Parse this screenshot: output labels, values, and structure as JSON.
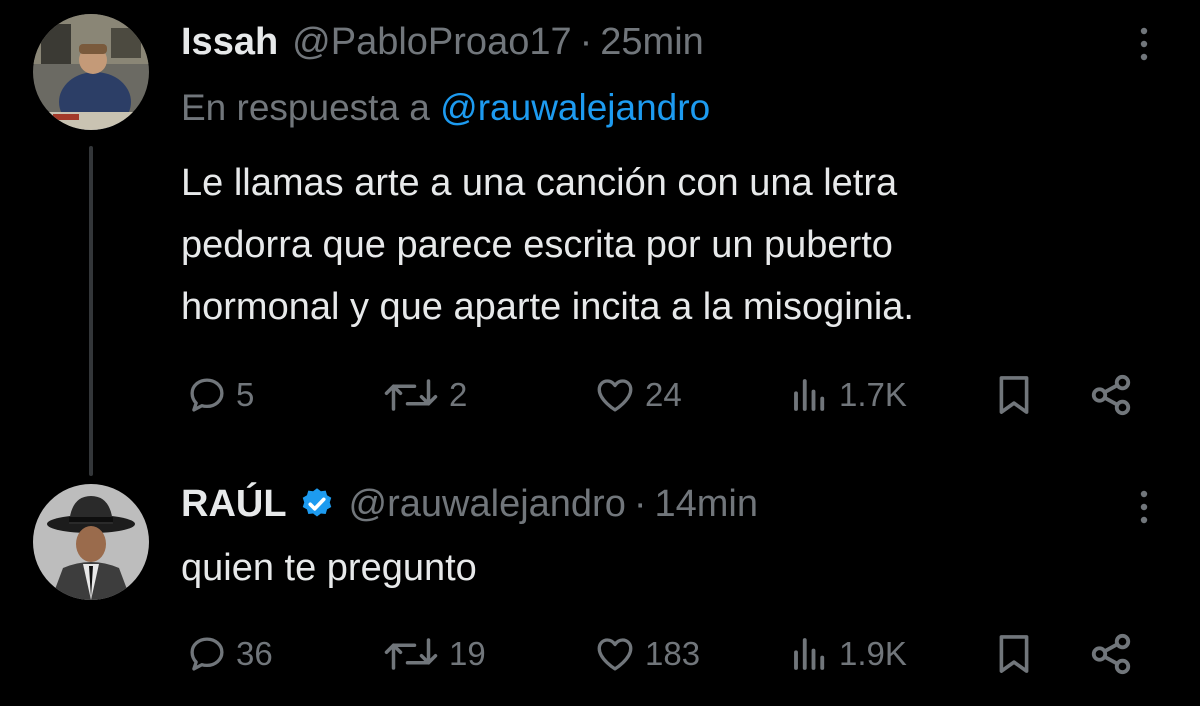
{
  "reply": {
    "author_name": "Issah",
    "handle": "@PabloProao17",
    "separator": "·",
    "time": "25min",
    "reply_prefix": "En respuesta a",
    "reply_mention": "@rauwalejandro",
    "text_lines": [
      "Le llamas arte a una canción con una letra",
      "pedorra que parece escrita por un puberto",
      "hormonal y que aparte incita a la misoginia."
    ],
    "stats": {
      "replies": "5",
      "reposts": "2",
      "likes": "24",
      "views": "1.7K"
    }
  },
  "response": {
    "author_name": "RAÚL",
    "verified": true,
    "handle": "@rauwalejandro",
    "separator": "·",
    "time": "14min",
    "text": "quien te pregunto",
    "stats": {
      "replies": "36",
      "reposts": "19",
      "likes": "183",
      "views": "1.9K"
    }
  },
  "icons": {
    "reply": "comment-bubble-icon",
    "repost": "repost-arrows-icon",
    "like": "heart-icon",
    "views": "bar-chart-icon",
    "bookmark": "bookmark-icon",
    "share": "share-icon",
    "more": "more-vertical-icon",
    "verified": "verified-badge-icon"
  },
  "colors": {
    "background": "#000000",
    "text_primary": "#e7e9ea",
    "text_secondary": "#71767b",
    "link": "#1d9bf0",
    "thread_line": "#333639"
  }
}
